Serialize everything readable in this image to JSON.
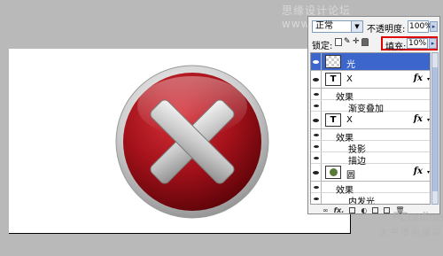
{
  "watermark_top": "思缘设计论坛 www.missyuan.com",
  "panel": {
    "blend_mode": "正常",
    "opacity_label": "不透明度:",
    "opacity_value": "100%",
    "lock_label": "锁定:",
    "fill_label": "填充:",
    "fill_value": "10%"
  },
  "layers": [
    {
      "type": "shape",
      "name": "光",
      "selected": true
    },
    {
      "type": "text",
      "thumb": "T",
      "name": "X",
      "fx": "fx",
      "effects_label": "效果",
      "effects": [
        "渐变叠加"
      ]
    },
    {
      "type": "text",
      "thumb": "T",
      "name": "X",
      "fx": "fx",
      "effects_label": "效果",
      "effects": [
        "投影",
        "描边"
      ]
    },
    {
      "type": "image",
      "name": "圆",
      "fx": "fx",
      "effects_label": "效果",
      "effects": [
        "内发光"
      ]
    }
  ],
  "bottom_bar": {
    "fx": "fx."
  },
  "watermark": {
    "logo": "PConline",
    "sub": "太平洋电脑网"
  },
  "colors": {
    "accent_red": "#e00000",
    "selected_layer": "#3d66cc",
    "button_red": "#b3141c"
  }
}
